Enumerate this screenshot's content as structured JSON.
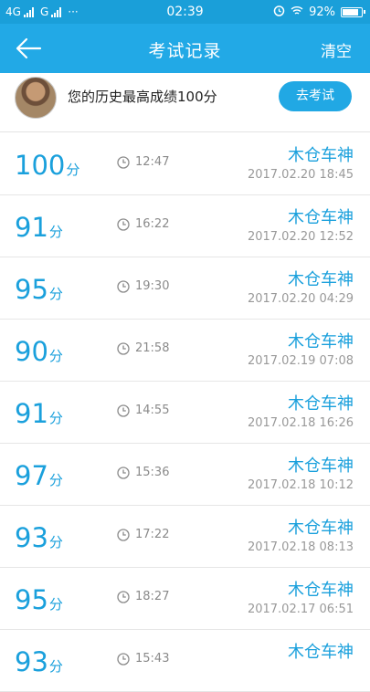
{
  "status_bar": {
    "network_1": "4G",
    "network_2": "G",
    "dots": "···",
    "time": "02:39",
    "battery": "92%",
    "battery_level": 0.92
  },
  "header": {
    "title": "考试记录",
    "clear_label": "清空"
  },
  "profile": {
    "best_score_text": "您的历史最高成绩100分",
    "exam_button_label": "去考试"
  },
  "records": [
    {
      "score": "100",
      "unit": "分",
      "duration": "12:47",
      "name": "木仓车神",
      "date": "2017.02.20 18:45"
    },
    {
      "score": "91",
      "unit": "分",
      "duration": "16:22",
      "name": "木仓车神",
      "date": "2017.02.20 12:52"
    },
    {
      "score": "95",
      "unit": "分",
      "duration": "19:30",
      "name": "木仓车神",
      "date": "2017.02.20 04:29"
    },
    {
      "score": "90",
      "unit": "分",
      "duration": "21:58",
      "name": "木仓车神",
      "date": "2017.02.19 07:08"
    },
    {
      "score": "91",
      "unit": "分",
      "duration": "14:55",
      "name": "木仓车神",
      "date": "2017.02.18 16:26"
    },
    {
      "score": "97",
      "unit": "分",
      "duration": "15:36",
      "name": "木仓车神",
      "date": "2017.02.18 10:12"
    },
    {
      "score": "93",
      "unit": "分",
      "duration": "17:22",
      "name": "木仓车神",
      "date": "2017.02.18 08:13"
    },
    {
      "score": "95",
      "unit": "分",
      "duration": "18:27",
      "name": "木仓车神",
      "date": "2017.02.17 06:51"
    },
    {
      "score": "93",
      "unit": "分",
      "duration": "15:43",
      "name": "木仓车神",
      "date": ""
    }
  ]
}
